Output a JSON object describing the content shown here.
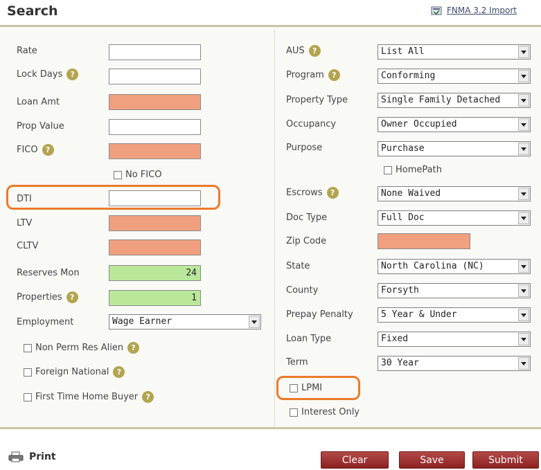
{
  "header": {
    "title": "Search",
    "import_label": "FNMA 3.2 Import",
    "import_icon": "import-file-icon"
  },
  "left": {
    "rate": {
      "label": "Rate",
      "value": ""
    },
    "lock_days": {
      "label": "Lock Days",
      "value": ""
    },
    "loan_amt": {
      "label": "Loan Amt",
      "value": ""
    },
    "prop_value": {
      "label": "Prop Value",
      "value": ""
    },
    "fico": {
      "label": "FICO",
      "value": ""
    },
    "no_fico": {
      "label": "No FICO",
      "checked": false
    },
    "dti": {
      "label": "DTI",
      "value": ""
    },
    "ltv": {
      "label": "LTV",
      "value": ""
    },
    "cltv": {
      "label": "CLTV",
      "value": ""
    },
    "reserves_mon": {
      "label": "Reserves Mon",
      "value": "24"
    },
    "properties": {
      "label": "Properties",
      "value": "1"
    },
    "employment": {
      "label": "Employment",
      "value": "Wage Earner"
    },
    "non_perm_res_alien": {
      "label": "Non Perm Res Alien",
      "checked": false
    },
    "foreign_national": {
      "label": "Foreign National",
      "checked": false
    },
    "first_time_home_buyer": {
      "label": "First Time Home Buyer",
      "checked": false
    }
  },
  "right": {
    "aus": {
      "label": "AUS",
      "value": "List All"
    },
    "program": {
      "label": "Program",
      "value": "Conforming"
    },
    "property_type": {
      "label": "Property Type",
      "value": "Single Family Detached"
    },
    "occupancy": {
      "label": "Occupancy",
      "value": "Owner Occupied"
    },
    "purpose": {
      "label": "Purpose",
      "value": "Purchase"
    },
    "homepath": {
      "label": "HomePath",
      "checked": false
    },
    "escrows": {
      "label": "Escrows",
      "value": "None Waived"
    },
    "doc_type": {
      "label": "Doc Type",
      "value": "Full Doc"
    },
    "zip_code": {
      "label": "Zip Code",
      "value": ""
    },
    "state": {
      "label": "State",
      "value": "North Carolina (NC)"
    },
    "county": {
      "label": "County",
      "value": "Forsyth"
    },
    "prepay_penalty": {
      "label": "Prepay Penalty",
      "value": "5 Year & Under"
    },
    "loan_type": {
      "label": "Loan Type",
      "value": "Fixed"
    },
    "term": {
      "label": "Term",
      "value": "30 Year"
    },
    "lpmi": {
      "label": "LPMI",
      "checked": false
    },
    "interest_only": {
      "label": "Interest Only",
      "checked": false
    }
  },
  "help_glyph": "?",
  "footer": {
    "print_label": "Print",
    "clear_label": "Clear",
    "save_label": "Save",
    "submit_label": "Submit"
  },
  "colors": {
    "required_field": "#f0a07e",
    "valid_field": "#b9e89a",
    "highlight": "#ec7a2c",
    "button": "#9b2e2d",
    "rule": "#c8c4a4"
  }
}
